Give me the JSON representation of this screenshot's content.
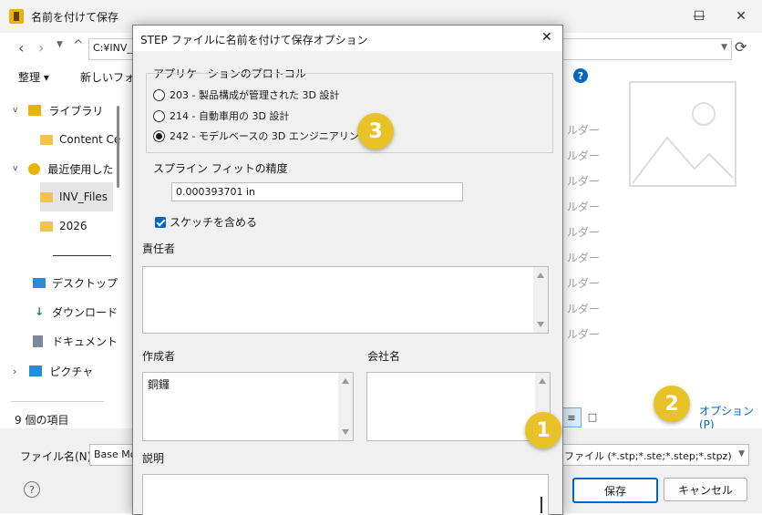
{
  "window": {
    "title": "名前を付けて保存",
    "minimize": "—",
    "maximize": "☐",
    "close": "✕"
  },
  "nav": {
    "path": "C:¥INV_F",
    "refresh_icon": "refresh-icon"
  },
  "toolbar": {
    "organize": "整理 ▾",
    "new_folder": "新しいフォル",
    "help": "?"
  },
  "sidebar": {
    "items": [
      {
        "label": "ライブラリ"
      },
      {
        "label": "Content Ce"
      },
      {
        "label": "最近使用した"
      },
      {
        "label": "INV_Files"
      },
      {
        "label": "2026"
      },
      {
        "label": "デスクトップ"
      },
      {
        "label": "ダウンロード"
      },
      {
        "label": "ドキュメント"
      },
      {
        "label": "ピクチャ"
      }
    ]
  },
  "list": {
    "folder_suffix": "ルダー",
    "rows": [
      "ルダー",
      "ルダー",
      "ルダー",
      "ルダー",
      "ルダー",
      "ルダー",
      "ルダー",
      "ルダー",
      "ルダー"
    ]
  },
  "status": {
    "count": "9 個の項目"
  },
  "options_link": "オプション(P)",
  "file": {
    "name_label": "ファイル名(N):",
    "name_value": "Base Mo",
    "type_value": "ファイル (*.stp;*.ste;*.step;*.stpz)",
    "save": "保存",
    "cancel": "キャンセル",
    "help": "?"
  },
  "dialog": {
    "title": "STEP ファイルに名前を付けて保存オプション",
    "close": "✕",
    "protocol_label": "アプリケーションのプロトコル",
    "protocols": [
      "203 - 製品構成が管理された 3D 設計",
      "214 - 自動車用の 3D 設計",
      "242 - モデルベースの 3D エンジニアリング"
    ],
    "selected_protocol": 2,
    "spline_label": "スプライン フィットの精度",
    "spline_value": "0.000393701 in",
    "sketch_label": "スケッチを含める",
    "sketch_checked": true,
    "responsible_label": "責任者",
    "responsible_value": "",
    "author_label": "作成者",
    "author_value": "銅鑼",
    "company_label": "会社名",
    "company_value": "",
    "description_label": "説明",
    "description_value": ""
  },
  "badges": {
    "b1": "1",
    "b2": "2",
    "b3": "3"
  },
  "colors": {
    "accent": "#0067c0",
    "badge": "#e8c227"
  }
}
